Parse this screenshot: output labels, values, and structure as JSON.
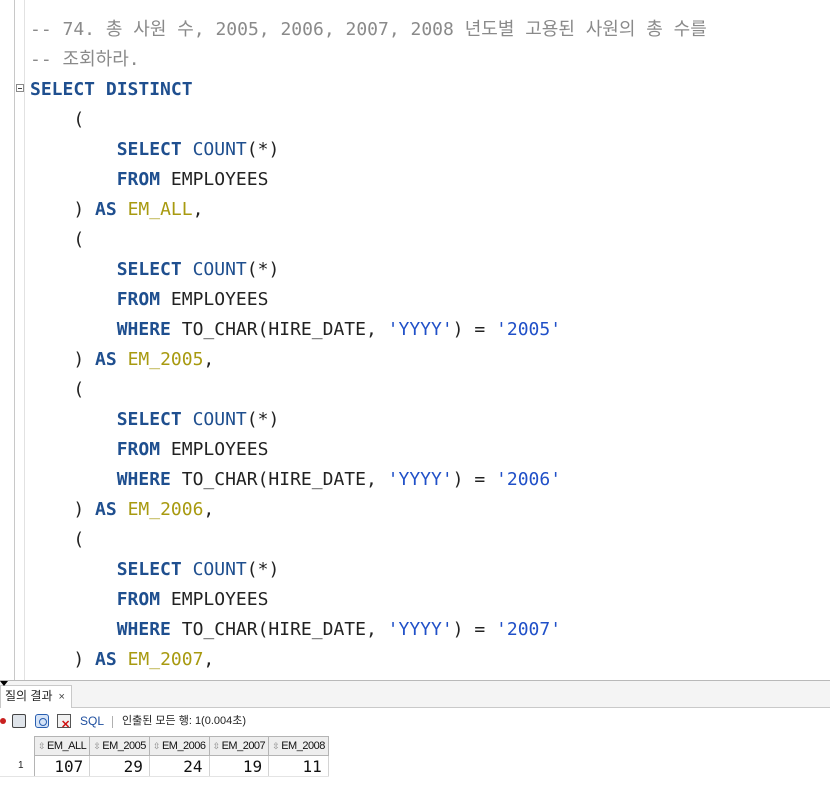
{
  "editor": {
    "lines": [
      [
        {
          "t": "comment",
          "v": "-- 74. 총 사원 수, 2005, 2006, 2007, 2008 년도별 고용된 사원의 총 수를"
        }
      ],
      [
        {
          "t": "comment",
          "v": "-- 조회하라."
        }
      ],
      [
        {
          "t": "kw",
          "v": "SELECT DISTINCT"
        }
      ],
      [
        {
          "t": "plain",
          "v": "    ("
        }
      ],
      [
        {
          "t": "plain",
          "v": "        "
        },
        {
          "t": "kw",
          "v": "SELECT"
        },
        {
          "t": "plain",
          "v": " "
        },
        {
          "t": "fn",
          "v": "COUNT"
        },
        {
          "t": "plain",
          "v": "(*)"
        }
      ],
      [
        {
          "t": "plain",
          "v": "        "
        },
        {
          "t": "kw",
          "v": "FROM"
        },
        {
          "t": "plain",
          "v": " EMPLOYEES"
        }
      ],
      [
        {
          "t": "plain",
          "v": "    ) "
        },
        {
          "t": "kw",
          "v": "AS"
        },
        {
          "t": "plain",
          "v": " "
        },
        {
          "t": "alias",
          "v": "EM_ALL"
        },
        {
          "t": "plain",
          "v": ","
        }
      ],
      [
        {
          "t": "plain",
          "v": "    ("
        }
      ],
      [
        {
          "t": "plain",
          "v": "        "
        },
        {
          "t": "kw",
          "v": "SELECT"
        },
        {
          "t": "plain",
          "v": " "
        },
        {
          "t": "fn",
          "v": "COUNT"
        },
        {
          "t": "plain",
          "v": "(*)"
        }
      ],
      [
        {
          "t": "plain",
          "v": "        "
        },
        {
          "t": "kw",
          "v": "FROM"
        },
        {
          "t": "plain",
          "v": " EMPLOYEES"
        }
      ],
      [
        {
          "t": "plain",
          "v": "        "
        },
        {
          "t": "kw",
          "v": "WHERE"
        },
        {
          "t": "plain",
          "v": " TO_CHAR(HIRE_DATE, "
        },
        {
          "t": "str",
          "v": "'YYYY'"
        },
        {
          "t": "plain",
          "v": ") = "
        },
        {
          "t": "str",
          "v": "'2005'"
        }
      ],
      [
        {
          "t": "plain",
          "v": "    ) "
        },
        {
          "t": "kw",
          "v": "AS"
        },
        {
          "t": "plain",
          "v": " "
        },
        {
          "t": "alias",
          "v": "EM_2005"
        },
        {
          "t": "plain",
          "v": ","
        }
      ],
      [
        {
          "t": "plain",
          "v": "    ("
        }
      ],
      [
        {
          "t": "plain",
          "v": "        "
        },
        {
          "t": "kw",
          "v": "SELECT"
        },
        {
          "t": "plain",
          "v": " "
        },
        {
          "t": "fn",
          "v": "COUNT"
        },
        {
          "t": "plain",
          "v": "(*)"
        }
      ],
      [
        {
          "t": "plain",
          "v": "        "
        },
        {
          "t": "kw",
          "v": "FROM"
        },
        {
          "t": "plain",
          "v": " EMPLOYEES"
        }
      ],
      [
        {
          "t": "plain",
          "v": "        "
        },
        {
          "t": "kw",
          "v": "WHERE"
        },
        {
          "t": "plain",
          "v": " TO_CHAR(HIRE_DATE, "
        },
        {
          "t": "str",
          "v": "'YYYY'"
        },
        {
          "t": "plain",
          "v": ") = "
        },
        {
          "t": "str",
          "v": "'2006'"
        }
      ],
      [
        {
          "t": "plain",
          "v": "    ) "
        },
        {
          "t": "kw",
          "v": "AS"
        },
        {
          "t": "plain",
          "v": " "
        },
        {
          "t": "alias",
          "v": "EM_2006"
        },
        {
          "t": "plain",
          "v": ","
        }
      ],
      [
        {
          "t": "plain",
          "v": "    ("
        }
      ],
      [
        {
          "t": "plain",
          "v": "        "
        },
        {
          "t": "kw",
          "v": "SELECT"
        },
        {
          "t": "plain",
          "v": " "
        },
        {
          "t": "fn",
          "v": "COUNT"
        },
        {
          "t": "plain",
          "v": "(*)"
        }
      ],
      [
        {
          "t": "plain",
          "v": "        "
        },
        {
          "t": "kw",
          "v": "FROM"
        },
        {
          "t": "plain",
          "v": " EMPLOYEES"
        }
      ],
      [
        {
          "t": "plain",
          "v": "        "
        },
        {
          "t": "kw",
          "v": "WHERE"
        },
        {
          "t": "plain",
          "v": " TO_CHAR(HIRE_DATE, "
        },
        {
          "t": "str",
          "v": "'YYYY'"
        },
        {
          "t": "plain",
          "v": ") = "
        },
        {
          "t": "str",
          "v": "'2007'"
        }
      ],
      [
        {
          "t": "plain",
          "v": "    ) "
        },
        {
          "t": "kw",
          "v": "AS"
        },
        {
          "t": "plain",
          "v": " "
        },
        {
          "t": "alias",
          "v": "EM_2007"
        },
        {
          "t": "plain",
          "v": ","
        }
      ]
    ]
  },
  "results": {
    "tab_label": "질의 결과",
    "tab_close": "×",
    "toolbar": {
      "sql_label": "SQL",
      "status": "인출된 모든 행: 1(0.004초)"
    },
    "columns": [
      "EM_ALL",
      "EM_2005",
      "EM_2006",
      "EM_2007",
      "EM_2008"
    ],
    "rows": [
      {
        "num": "1",
        "cells": [
          "107",
          "29",
          "24",
          "19",
          "11"
        ]
      }
    ]
  },
  "colors": {
    "keyword": "#1f4f8f",
    "string": "#2050c8",
    "alias": "#a89a10",
    "comment": "#8a8a8a"
  }
}
